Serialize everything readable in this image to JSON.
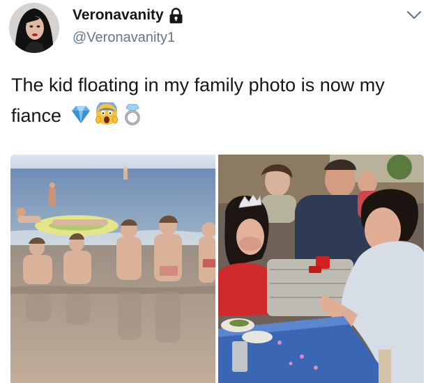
{
  "tweet": {
    "display_name": "Veronavanity",
    "handle": "@Veronavanity1",
    "text": "The kid floating in my family photo is now my fiance",
    "emojis": [
      "gem-icon",
      "screaming-face-icon",
      "ring-icon"
    ],
    "protected_account": true
  },
  "media": {
    "photos": [
      "beach-family-photo",
      "proposal-photo"
    ]
  },
  "colors": {
    "name_text": "#14171a",
    "handle_text": "#657786",
    "chevron": "#657786"
  }
}
